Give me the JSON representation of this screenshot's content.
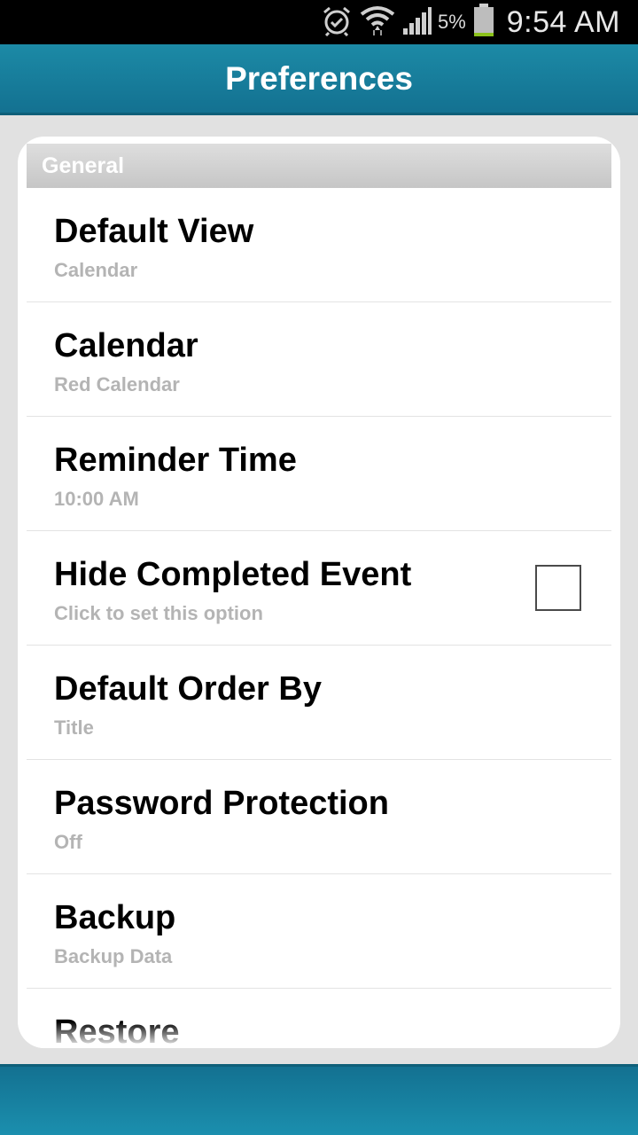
{
  "status_bar": {
    "battery_percent": "5%",
    "time": "9:54 AM",
    "icons": [
      "alarm-icon",
      "wifi-icon",
      "signal-icon",
      "battery-icon"
    ]
  },
  "header": {
    "title": "Preferences"
  },
  "section": {
    "title": "General"
  },
  "preferences": [
    {
      "title": "Default View",
      "summary": "Calendar"
    },
    {
      "title": "Calendar",
      "summary": "Red Calendar"
    },
    {
      "title": "Reminder Time",
      "summary": "10:00 AM"
    },
    {
      "title": "Hide Completed Event",
      "summary": "Click to set this option",
      "checked": false
    },
    {
      "title": "Default Order By",
      "summary": "Title"
    },
    {
      "title": "Password Protection",
      "summary": "Off"
    },
    {
      "title": "Backup",
      "summary": "Backup Data"
    },
    {
      "title": "Restore",
      "summary": ""
    }
  ],
  "colors": {
    "accent": "#137191",
    "summary_text": "#b4b4b4",
    "battery_level": "#8bc21b"
  }
}
